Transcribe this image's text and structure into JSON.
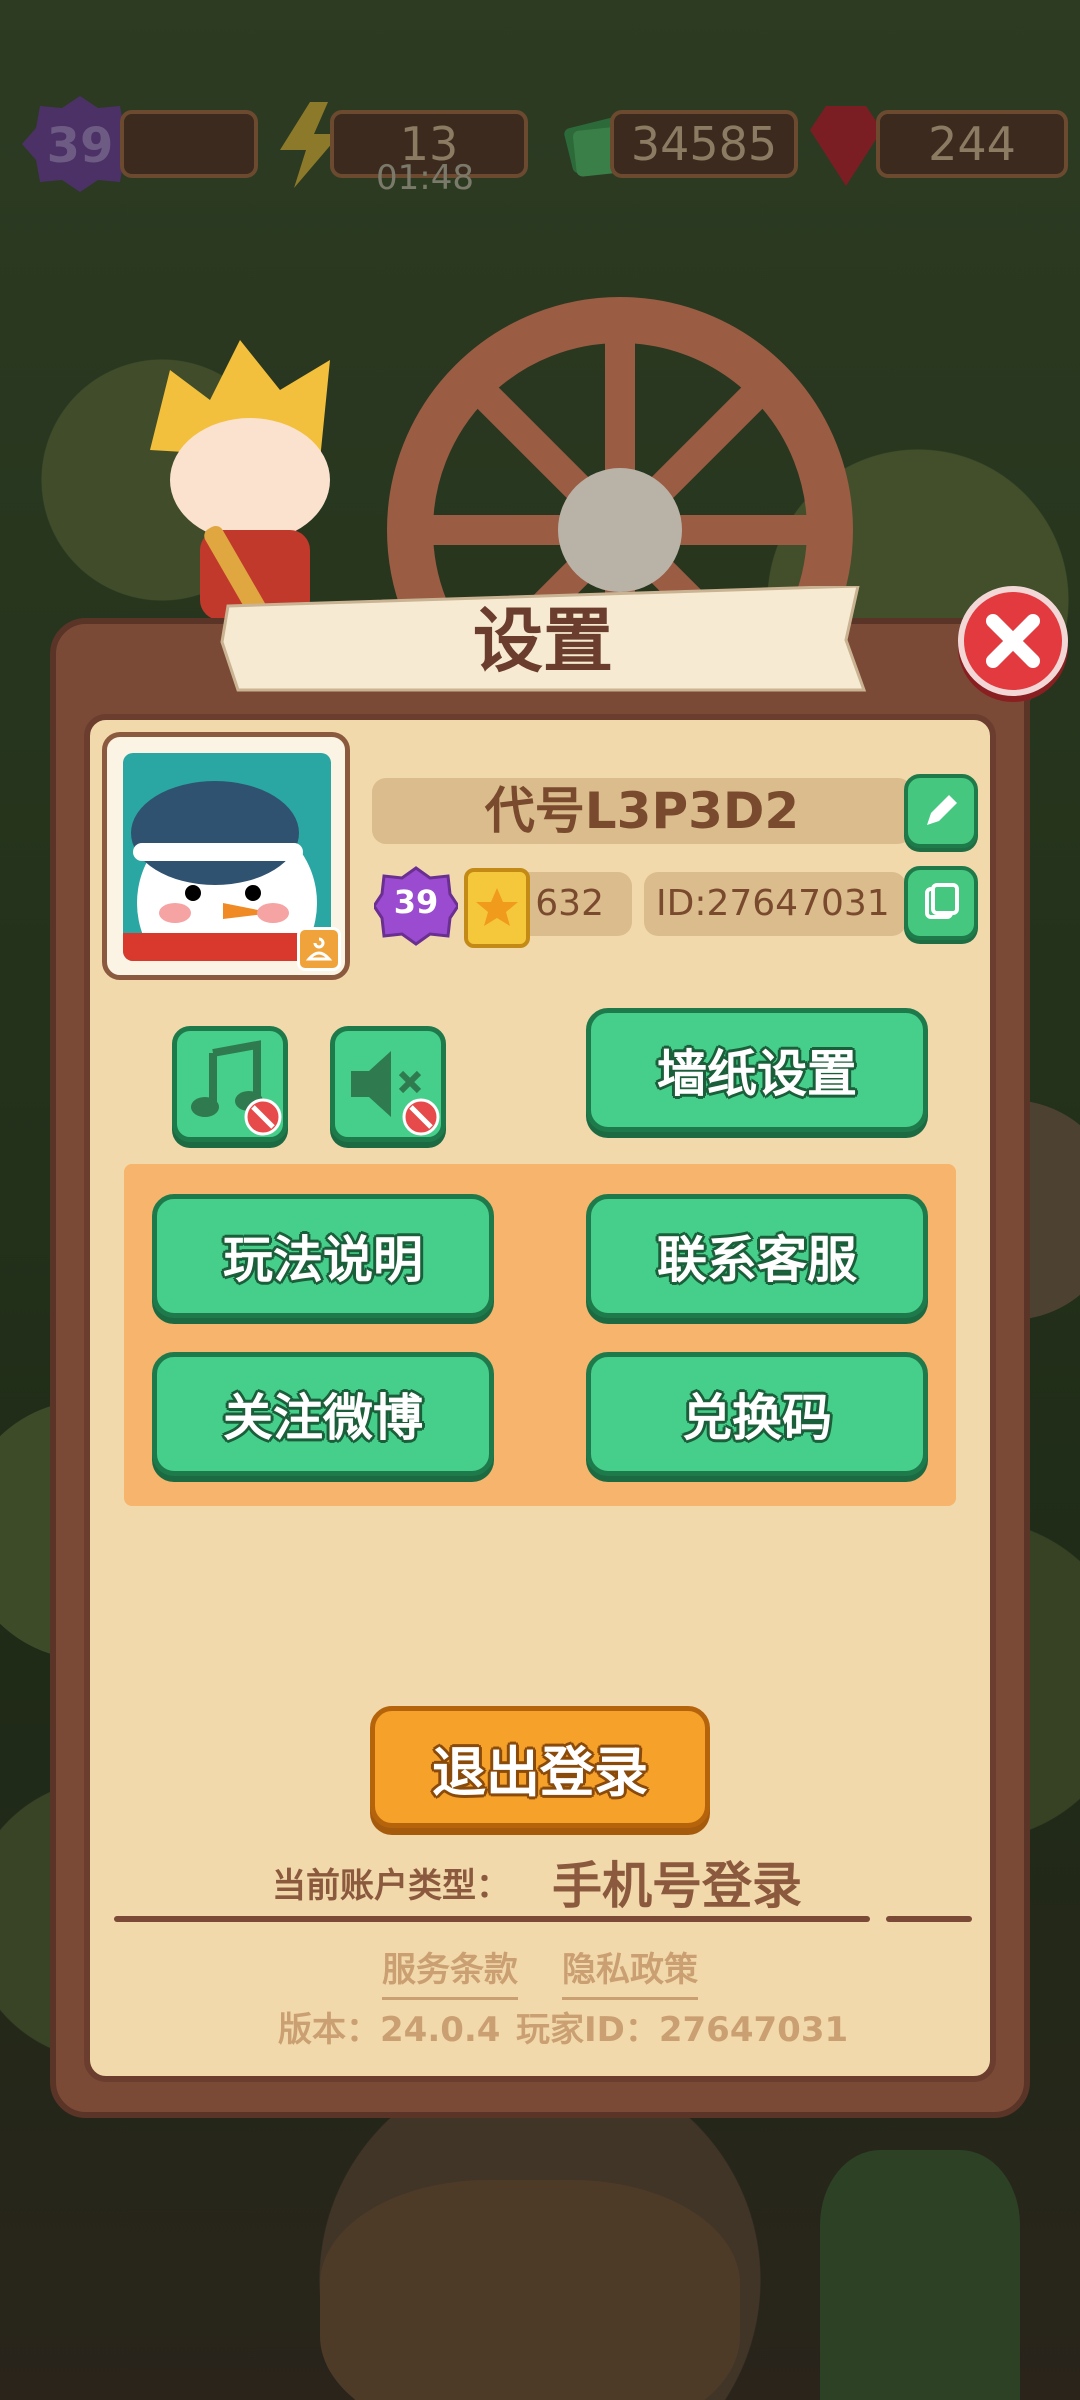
{
  "hud": {
    "level": "39",
    "energy": "13",
    "energy_timer": "01:48",
    "cash": "34585",
    "gems": "244"
  },
  "dialog": {
    "title": "设置",
    "player_name": "代号L3P3D2",
    "player_level": "39",
    "stars": "632",
    "player_id": "ID:27647031",
    "wallpaper_button": "墙纸设置",
    "howto_button": "玩法说明",
    "support_button": "联系客服",
    "weibo_button": "关注微博",
    "redeem_button": "兑换码",
    "logout_button": "退出登录",
    "account_type_label": "当前账户类型：",
    "account_type_value": "手机号登录",
    "terms_link": "服务条款",
    "privacy_link": "隐私政策",
    "version_text": "版本：24.0.4",
    "player_id_footer": "玩家ID：27647031"
  },
  "colors": {
    "green_button": "#45cf8b",
    "orange_button": "#f5a12a",
    "close_red": "#e23a3f",
    "panel_bg": "#f2d9ac"
  }
}
